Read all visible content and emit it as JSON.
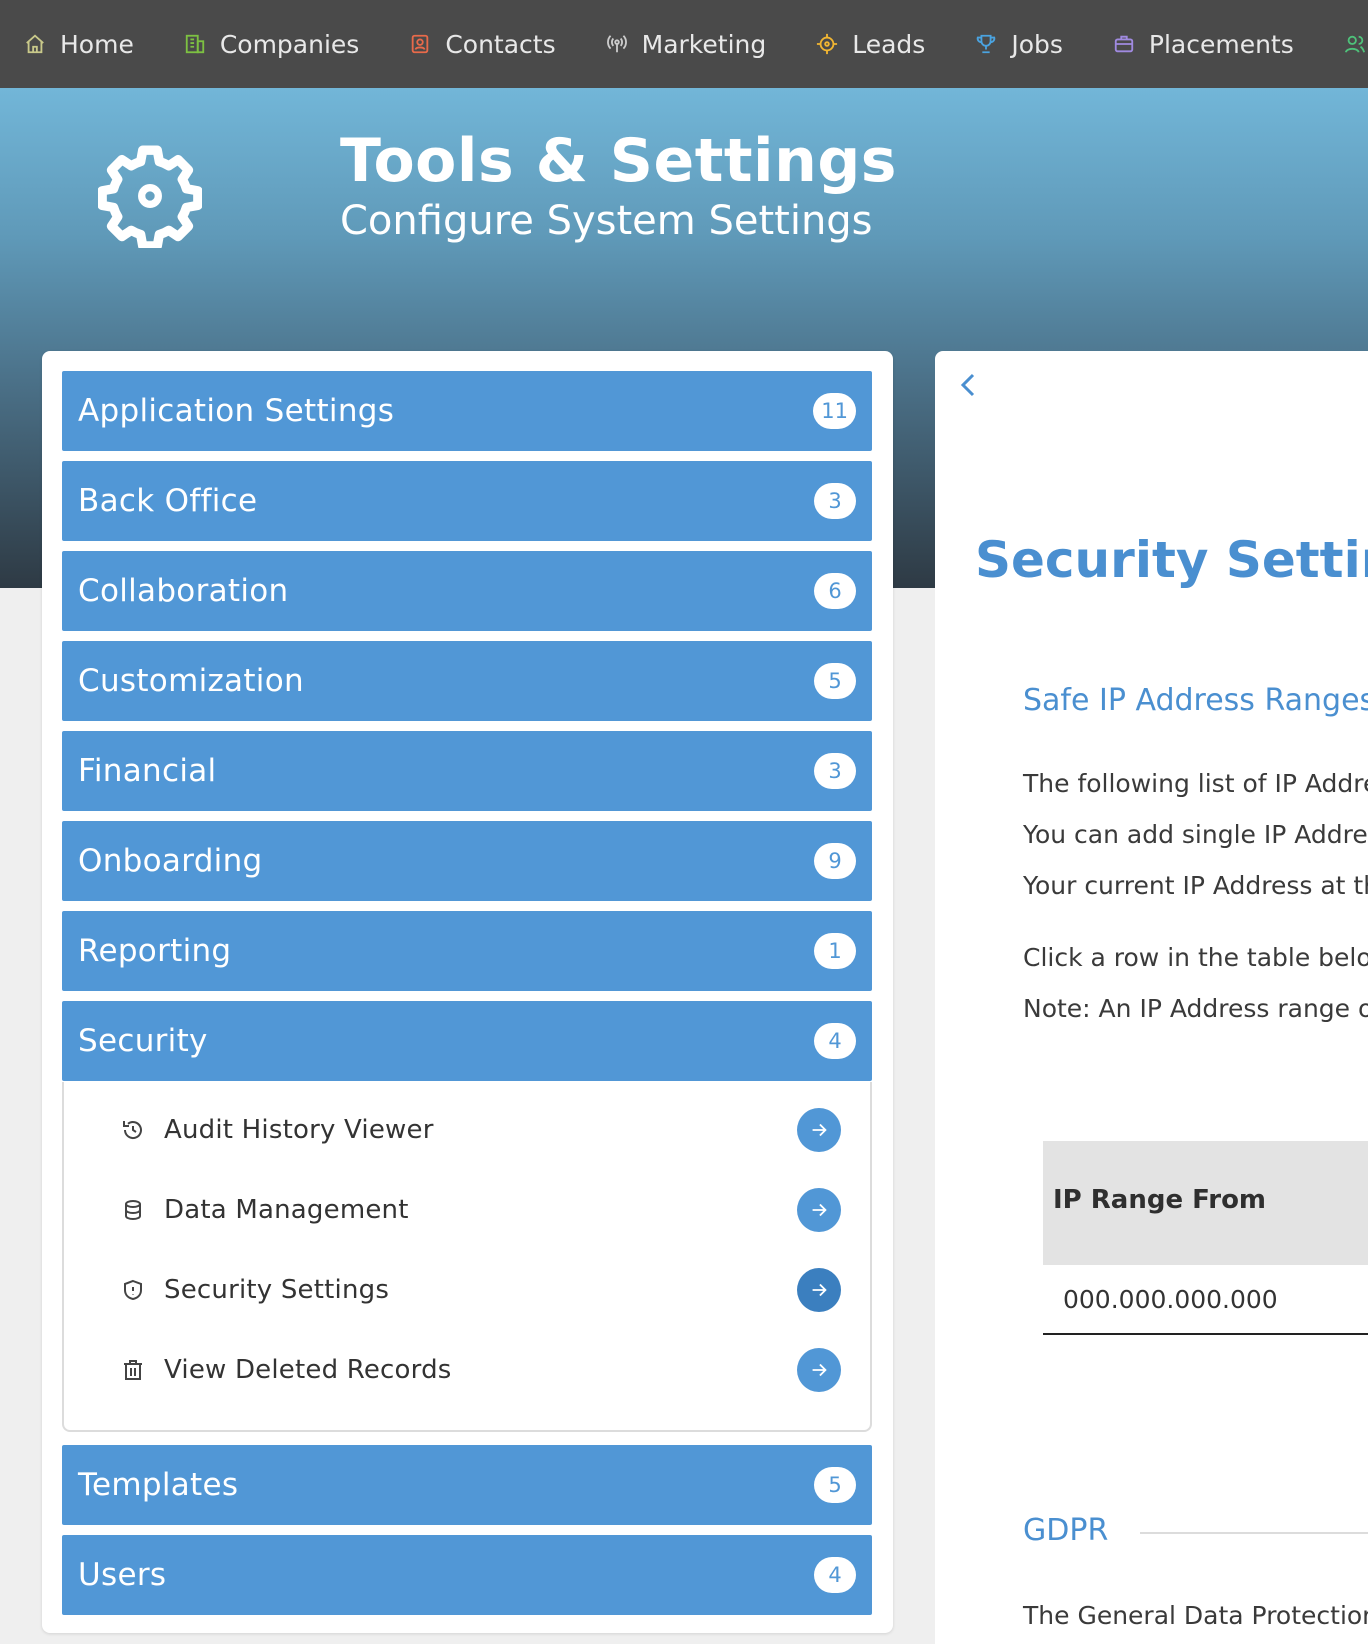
{
  "nav": {
    "items": [
      {
        "label": "Home",
        "icon": "home-icon",
        "color": "#c9c98a"
      },
      {
        "label": "Companies",
        "icon": "building-icon",
        "color": "#7dc142"
      },
      {
        "label": "Contacts",
        "icon": "contact-card-icon",
        "color": "#e86a4a"
      },
      {
        "label": "Marketing",
        "icon": "broadcast-icon",
        "color": "#cccccc"
      },
      {
        "label": "Leads",
        "icon": "crosshair-icon",
        "color": "#f2b632"
      },
      {
        "label": "Jobs",
        "icon": "trophy-icon",
        "color": "#4aa3e0"
      },
      {
        "label": "Placements",
        "icon": "briefcase-icon",
        "color": "#a08ae0"
      },
      {
        "label": "",
        "icon": "users-icon",
        "color": "#4ec27a"
      }
    ]
  },
  "hero": {
    "title": "Tools & Settings",
    "subtitle": "Configure System Settings"
  },
  "categories": [
    {
      "label": "Application Settings",
      "count": "11"
    },
    {
      "label": "Back Office",
      "count": "3"
    },
    {
      "label": "Collaboration",
      "count": "6"
    },
    {
      "label": "Customization",
      "count": "5"
    },
    {
      "label": "Financial",
      "count": "3"
    },
    {
      "label": "Onboarding",
      "count": "9"
    },
    {
      "label": "Reporting",
      "count": "1"
    },
    {
      "label": "Security",
      "count": "4"
    },
    {
      "label": "Templates",
      "count": "5"
    },
    {
      "label": "Users",
      "count": "4"
    }
  ],
  "security_items": [
    {
      "label": "Audit History Viewer",
      "icon": "history-icon"
    },
    {
      "label": "Data Management",
      "icon": "database-icon"
    },
    {
      "label": "Security Settings",
      "icon": "shield-icon"
    },
    {
      "label": "View Deleted Records",
      "icon": "trash-icon"
    }
  ],
  "detail": {
    "title": "Security Settings",
    "section": "Safe IP Address Ranges",
    "lines": [
      "The following list of IP Addre",
      "You can add single IP Addre",
      "Your current IP Address at th",
      "Click a row in the table belov",
      "Note: An IP Address range o"
    ],
    "table": {
      "header": "IP Range From",
      "row": "000.000.000.000"
    },
    "gdpr_heading": "GDPR",
    "gdpr_text": "The General Data Protection"
  },
  "colors": {
    "accent": "#5197d6",
    "nav_bg": "#4a4a4a",
    "title_blue": "#4a8fd0"
  }
}
